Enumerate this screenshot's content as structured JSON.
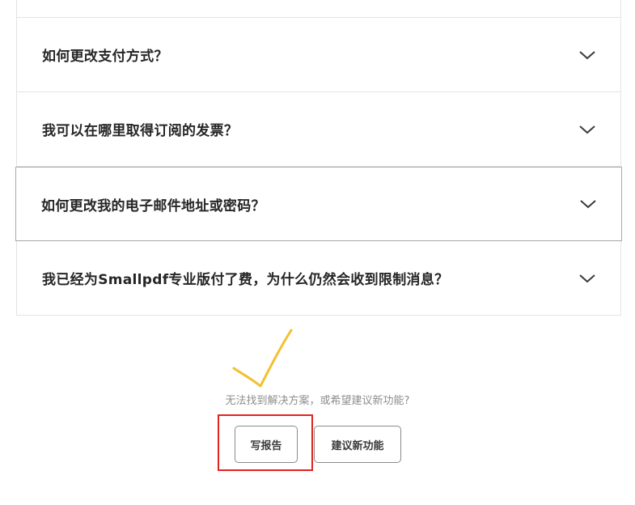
{
  "faq": {
    "items": [
      {
        "question": "如何更改支付方式？",
        "expanded": false
      },
      {
        "question": "我可以在哪里取得订阅的发票？",
        "expanded": false
      },
      {
        "question": "如何更改我的电子邮件地址或密码？",
        "expanded": false,
        "hovered": true
      },
      {
        "question": "我已经为Smallpdf专业版付了费，为什么仍然会收到限制消息？",
        "expanded": false
      }
    ],
    "chevron_icon": "chevron-down-icon"
  },
  "footer": {
    "hint": "无法找到解决方案，或希望建议新功能?",
    "report_button": "写报告",
    "suggest_button": "建议新功能"
  },
  "annotations": {
    "checkmark_color": "#f2c12e",
    "highlight_color": "#e2241f"
  }
}
